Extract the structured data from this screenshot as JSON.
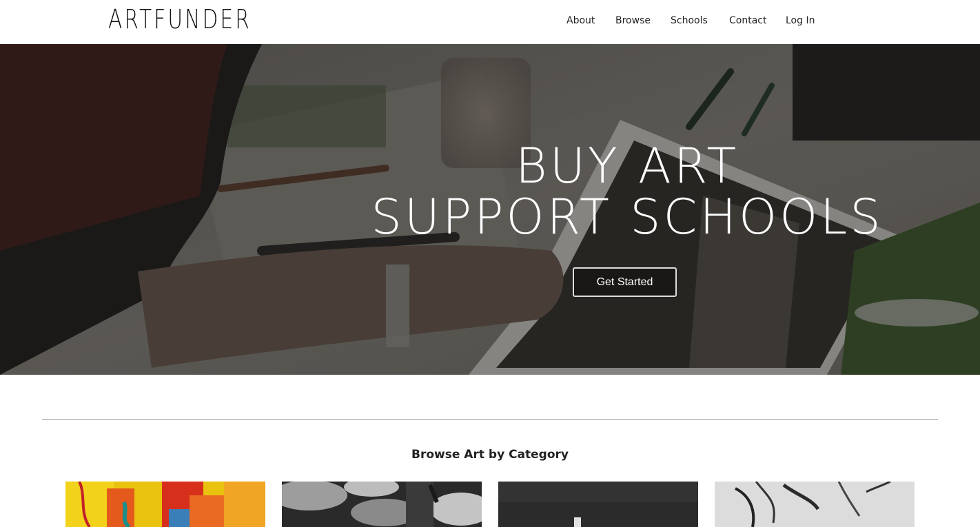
{
  "header": {
    "logo": "ARTFUNDER",
    "nav": [
      "About",
      "Browse",
      "Schools",
      "Contact",
      "Log In"
    ]
  },
  "hero": {
    "title_line1": "BUY ART",
    "title_line2": "SUPPORT SCHOOLS",
    "cta_label": "Get Started"
  },
  "categories": {
    "heading": "Browse Art by Category"
  },
  "colors": {
    "hero_overlay": "#1e1c1a",
    "divider": "#999999"
  }
}
